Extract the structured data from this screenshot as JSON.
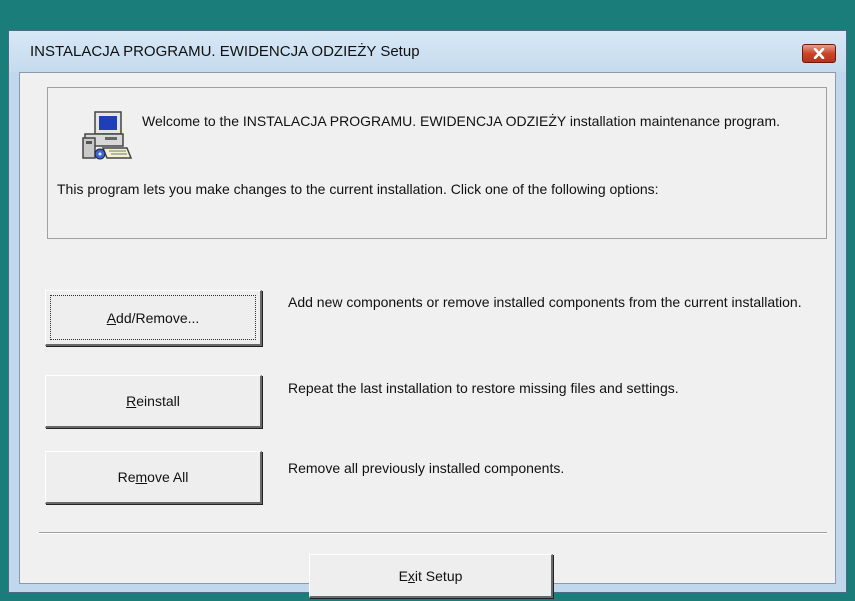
{
  "window": {
    "title": "INSTALACJA PROGRAMU. EWIDENCJA ODZIEŻY Setup",
    "close_icon": "close-icon"
  },
  "intro": {
    "icon": "setup-computer-icon",
    "welcome": "Welcome to the INSTALACJA PROGRAMU. EWIDENCJA ODZIEŻY installation maintenance program.",
    "info": "This program lets you make changes to the current installation. Click one of the following options:"
  },
  "options": [
    {
      "label_pre": "",
      "label_hotkey": "A",
      "label_post": "dd/Remove...",
      "description": "Add new components or remove installed components from the current installation."
    },
    {
      "label_pre": "",
      "label_hotkey": "R",
      "label_post": "einstall",
      "description": "Repeat the last installation to restore missing files and settings."
    },
    {
      "label_pre": "Re",
      "label_hotkey": "m",
      "label_post": "ove All",
      "description": "Remove all previously installed components."
    }
  ],
  "exit": {
    "label_pre": "E",
    "label_hotkey": "x",
    "label_post": "it Setup"
  }
}
